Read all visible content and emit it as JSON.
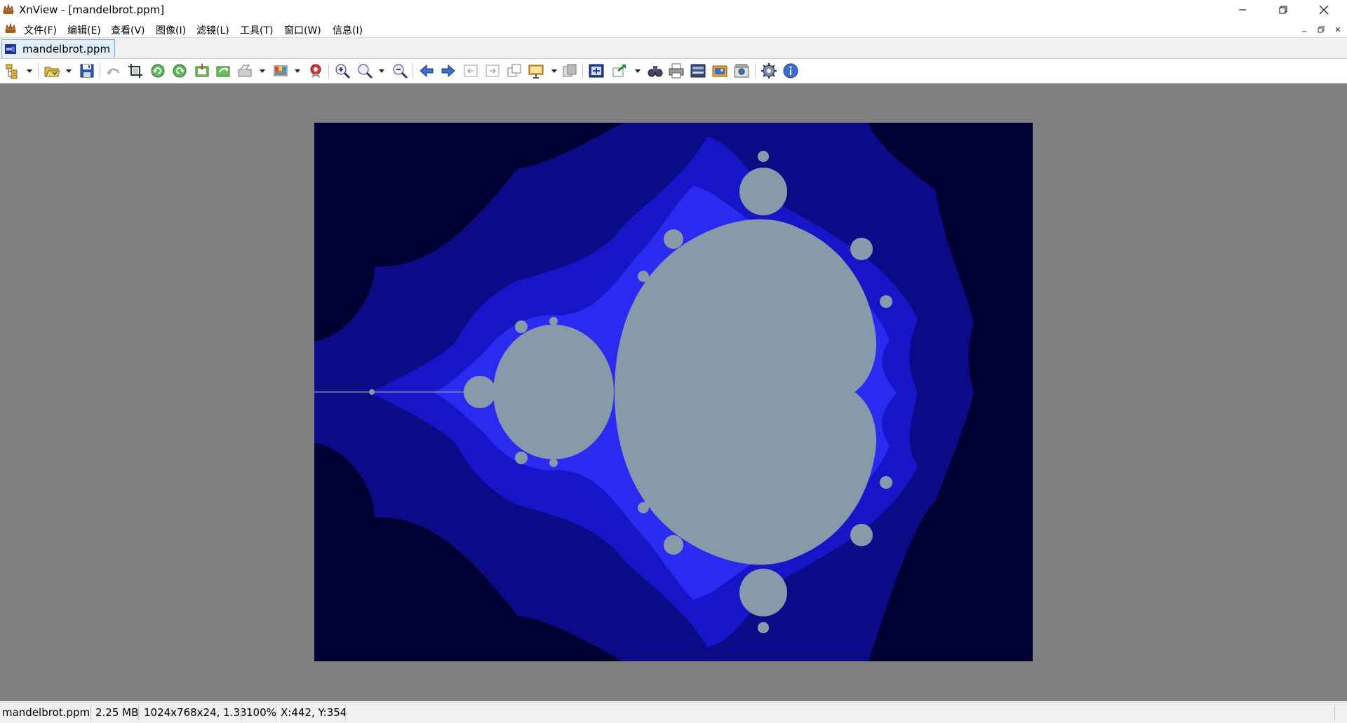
{
  "window": {
    "title": "XnView - [mandelbrot.ppm]"
  },
  "menu": {
    "items": [
      {
        "label": "文件(F)"
      },
      {
        "label": "编辑(E)"
      },
      {
        "label": "查看(V)"
      },
      {
        "label": "图像(I)"
      },
      {
        "label": "滤镜(L)"
      },
      {
        "label": "工具(T)"
      },
      {
        "label": "窗口(W)"
      },
      {
        "label": "信息(I)"
      }
    ]
  },
  "tab": {
    "label": "mandelbrot.ppm"
  },
  "image": {
    "colors": {
      "background": "#000033",
      "outer_band": "#0b0b88",
      "mid_band": "#1616c8",
      "inner_band": "#2a2af0",
      "set": "#8899aa"
    }
  },
  "status": {
    "filename": "mandelbrot.ppm",
    "filesize": "2.25 MB",
    "dimensions": "1024x768x24, 1.33",
    "zoom": "100%",
    "coords": "X:442, Y:354"
  },
  "icons": {
    "titlebar": [
      "app-icon",
      "minimize-icon",
      "restore-icon",
      "close-icon"
    ],
    "toolbar": [
      "browser-icon",
      "open-folder-icon",
      "save-icon",
      "undo-icon",
      "crop-icon",
      "rotate-left-icon",
      "rotate-right-icon",
      "import-icon",
      "export-icon",
      "scanner-icon",
      "palette-icon",
      "effects-icon",
      "zoom-in-icon",
      "zoom-icon",
      "zoom-out-icon",
      "previous-icon",
      "next-icon",
      "first-icon",
      "last-icon",
      "copy-icon",
      "slideshow-icon",
      "batch-icon",
      "fit-window-icon",
      "convert-icon",
      "find-icon",
      "print-icon",
      "scan-icon",
      "wallpaper-icon",
      "capture-icon",
      "settings-icon",
      "info-icon"
    ]
  }
}
